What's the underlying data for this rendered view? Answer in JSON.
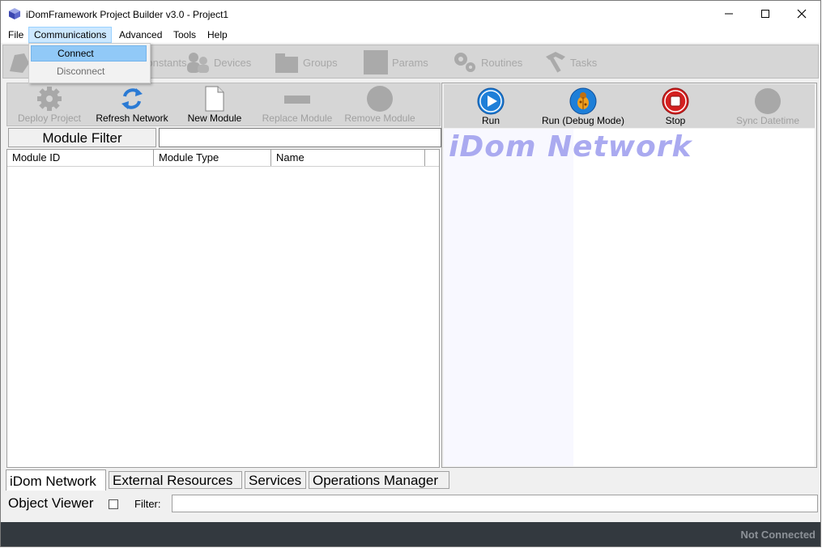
{
  "window": {
    "title": "iDomFramework Project Builder v3.0 - Project1"
  },
  "menubar": {
    "items": [
      "File",
      "Communications",
      "Advanced",
      "Tools",
      "Help"
    ],
    "active": "Communications"
  },
  "dropdown": {
    "items": [
      {
        "label": "Connect",
        "state": "highlighted"
      },
      {
        "label": "Disconnect",
        "state": "disabled"
      }
    ]
  },
  "main_toolbar": {
    "constants_label": "Constants",
    "devices_label": "Devices",
    "groups_label": "Groups",
    "params_label": "Params",
    "routines_label": "Routines",
    "tasks_label": "Tasks"
  },
  "left_toolbar": {
    "deploy_label": "Deploy Project",
    "refresh_label": "Refresh Network",
    "new_module_label": "New Module",
    "replace_label": "Replace Module",
    "remove_label": "Remove Module"
  },
  "module_filter": {
    "label": "Module Filter",
    "value": ""
  },
  "module_table": {
    "columns": [
      "Module ID",
      "Module Type",
      "Name"
    ],
    "rows": []
  },
  "right_toolbar": {
    "run_label": "Run",
    "debug_label": "Run (Debug Mode)",
    "stop_label": "Stop",
    "sync_label": "Sync Datetime"
  },
  "canvas": {
    "title": "iDom Network"
  },
  "tabs": [
    "iDom Network",
    "External Resources",
    "Services",
    "Operations Manager"
  ],
  "active_tab": "iDom Network",
  "object_viewer": {
    "label": "Object Viewer",
    "checked": false,
    "filter_label": "Filter:",
    "filter_value": ""
  },
  "status": {
    "text": "Not Connected"
  },
  "colors": {
    "status_bar": "#33393f",
    "menu_highlight": "#cce8ff",
    "dropdown_highlight": "#91c9f7",
    "canvas_title": "#aaaaf0",
    "run_blue": "#1e7fd8",
    "stop_red": "#d42020"
  },
  "icons": {
    "app": "cube-icon",
    "constants": "constants-icon",
    "devices": "devices-icon",
    "groups": "groups-icon",
    "params": "params-icon",
    "routines": "gears-icon",
    "tasks": "hammer-icon",
    "deploy": "gear-icon",
    "refresh": "refresh-icon",
    "new_module": "document-icon",
    "replace": "replace-icon",
    "remove": "remove-icon",
    "run": "play-icon",
    "debug": "bug-icon",
    "stop": "stop-icon",
    "sync": "clock-icon"
  }
}
